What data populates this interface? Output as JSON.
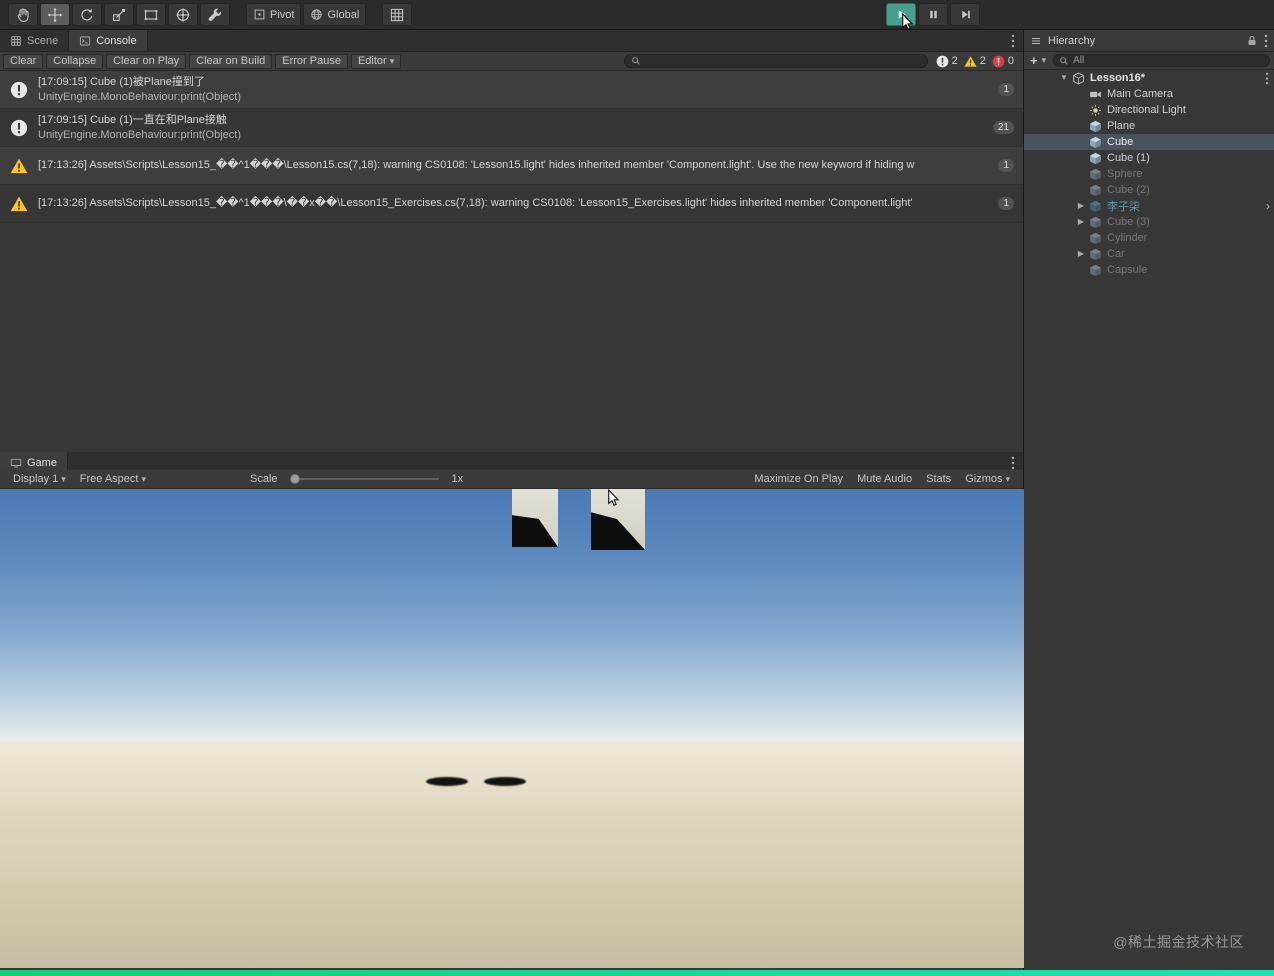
{
  "top_toolbar": {
    "pivot_label": "Pivot",
    "global_label": "Global",
    "tool_icons": [
      "hand-tool",
      "move-tool",
      "rotate-tool",
      "scale-tool",
      "rect-tool",
      "transform-tool",
      "custom-tool",
      "grid-snap"
    ],
    "transport_icons": [
      "play",
      "pause",
      "step"
    ],
    "play_active": true
  },
  "console_panel": {
    "tabs": {
      "scene": "Scene",
      "console": "Console"
    },
    "toolbar": {
      "clear": "Clear",
      "collapse": "Collapse",
      "clear_on_play": "Clear on Play",
      "clear_on_build": "Clear on Build",
      "error_pause": "Error Pause",
      "editor": "Editor"
    },
    "counts": {
      "logs": "2",
      "warnings": "2",
      "errors": "0"
    },
    "entries": [
      {
        "severity": "log",
        "line1": "[17:09:15] Cube (1)被Plane撞到了",
        "line2": "UnityEngine.MonoBehaviour:print(Object)",
        "badge": "1"
      },
      {
        "severity": "log",
        "line1": "[17:09:15] Cube (1)一直在和Plane接触",
        "line2": "UnityEngine.MonoBehaviour:print(Object)",
        "badge": "21"
      },
      {
        "severity": "warning",
        "line1": "[17:13:26] Assets\\Scripts\\Lesson15_��^1���\\Lesson15.cs(7,18): warning CS0108: 'Lesson15.light' hides inherited member 'Component.light'. Use the new keyword if hiding w",
        "badge": "1"
      },
      {
        "severity": "warning",
        "line1": "[17:13:26] Assets\\Scripts\\Lesson15_��^1���\\��x��\\Lesson15_Exercises.cs(7,18): warning CS0108: 'Lesson15_Exercises.light' hides inherited member 'Component.light'",
        "badge": "1"
      }
    ]
  },
  "game_panel": {
    "tab": "Game",
    "display": "Display 1",
    "aspect": "Free Aspect",
    "scale_label": "Scale",
    "scale_value": "1x",
    "maximize": "Maximize On Play",
    "mute": "Mute Audio",
    "stats": "Stats",
    "gizmos": "Gizmos"
  },
  "hierarchy": {
    "title": "Hierarchy",
    "search_value": "All",
    "items": [
      {
        "label": "Lesson16*",
        "type": "scene",
        "expanded": true
      },
      {
        "label": "Main Camera",
        "type": "camera"
      },
      {
        "label": "Directional Light",
        "type": "light"
      },
      {
        "label": "Plane",
        "type": "mesh"
      },
      {
        "label": "Cube",
        "type": "mesh",
        "selected": true
      },
      {
        "label": "Cube (1)",
        "type": "mesh"
      },
      {
        "label": "Sphere",
        "type": "mesh",
        "inactive": true
      },
      {
        "label": "Cube (2)",
        "type": "mesh",
        "inactive": true
      },
      {
        "label": "李子柒",
        "type": "prefab",
        "inactive": true
      },
      {
        "label": "Cube (3)",
        "type": "mesh",
        "inactive": true
      },
      {
        "label": "Cylinder",
        "type": "mesh",
        "inactive": true
      },
      {
        "label": "Car",
        "type": "mesh",
        "inactive": true
      },
      {
        "label": "Capsule",
        "type": "mesh",
        "inactive": true
      }
    ]
  },
  "watermark": "@稀土掘金技术社区",
  "colors": {
    "play_tint": "#47a08e",
    "selection": "#47535f",
    "prefab_text": "#54a0ad",
    "warning_yellow": "#ffc22e",
    "error_red": "#e23c3c",
    "bottom_bar": "#12cf75"
  }
}
